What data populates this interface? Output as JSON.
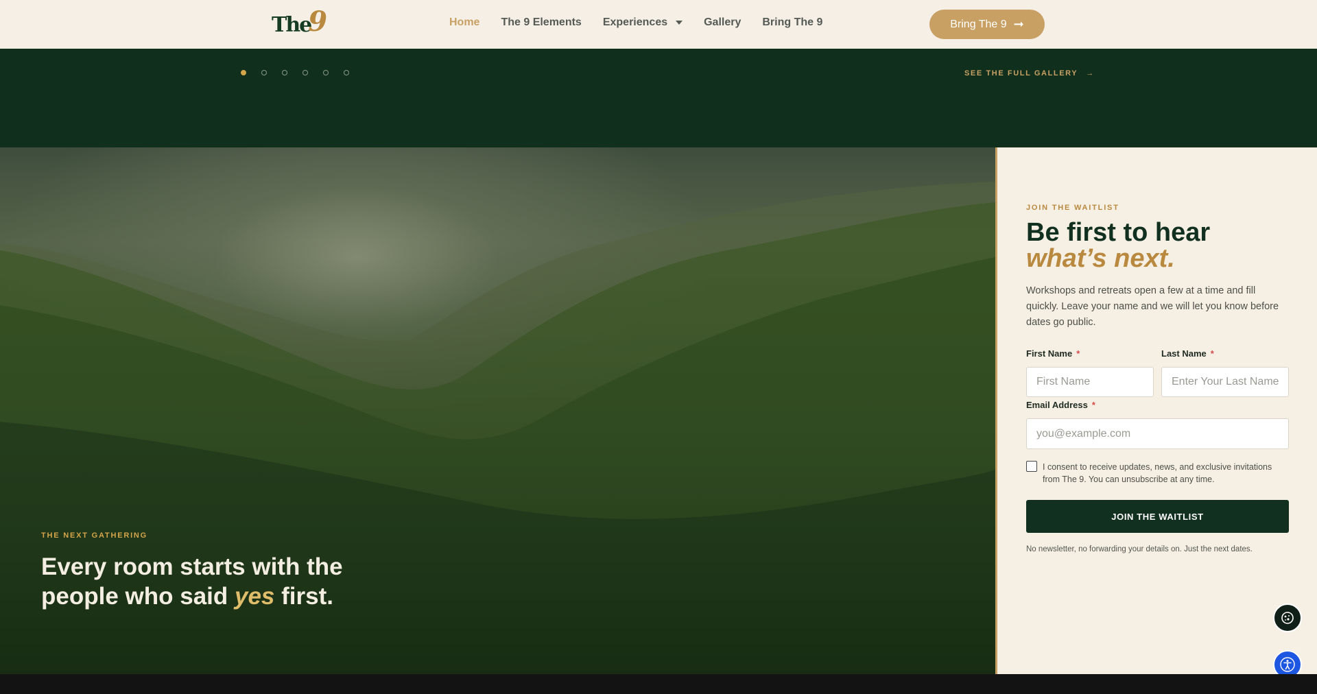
{
  "header": {
    "logo": {
      "word": "The",
      "number": "9"
    },
    "nav": [
      {
        "label": "Home",
        "active": true
      },
      {
        "label": "The 9 Elements",
        "active": false
      },
      {
        "label": "Experiences",
        "active": false,
        "dropdown": true
      },
      {
        "label": "Gallery",
        "active": false
      },
      {
        "label": "Bring The 9",
        "active": false
      }
    ],
    "cta": {
      "label": "Bring The 9",
      "icon": "arrow-right-icon"
    }
  },
  "carousel": {
    "dot_count": 6,
    "active_index": 0,
    "gallery_link": "SEE THE FULL GALLERY"
  },
  "hero": {
    "eyebrow": "THE NEXT GATHERING",
    "title_part1": "Every room starts with the people who said ",
    "title_emphasis": "yes",
    "title_part2": " first."
  },
  "waitlist": {
    "eyebrow": "JOIN THE WAITLIST",
    "title_line1": "Be first to hear",
    "title_line2": "what’s next.",
    "description": "Workshops and retreats open a few at a time and fill quickly. Leave your name and we will let you know before dates go public.",
    "fields": {
      "first_name": {
        "label": "First Name",
        "required": "*",
        "placeholder": "First Name",
        "value": ""
      },
      "last_name": {
        "label": "Last Name",
        "required": "*",
        "placeholder": "Enter Your Last Name",
        "value": ""
      },
      "email": {
        "label": "Email Address",
        "required": "*",
        "placeholder": "you@example.com",
        "value": ""
      }
    },
    "consent": {
      "checked": false,
      "text": "I consent to receive updates, news, and exclusive invitations from The 9. You can unsubscribe at any time."
    },
    "submit_label": "JOIN THE WAITLIST",
    "fineprint": "No newsletter, no forwarding your details on. Just the next dates."
  },
  "floating": {
    "cookie_icon": "cookie-settings-icon",
    "accessibility_icon": "accessibility-icon"
  },
  "colors": {
    "cream": "#f5efe6",
    "gold": "#c9a064",
    "forest": "#10301d",
    "nav_text": "#555a55",
    "accessibility_blue": "#1d56e0"
  }
}
